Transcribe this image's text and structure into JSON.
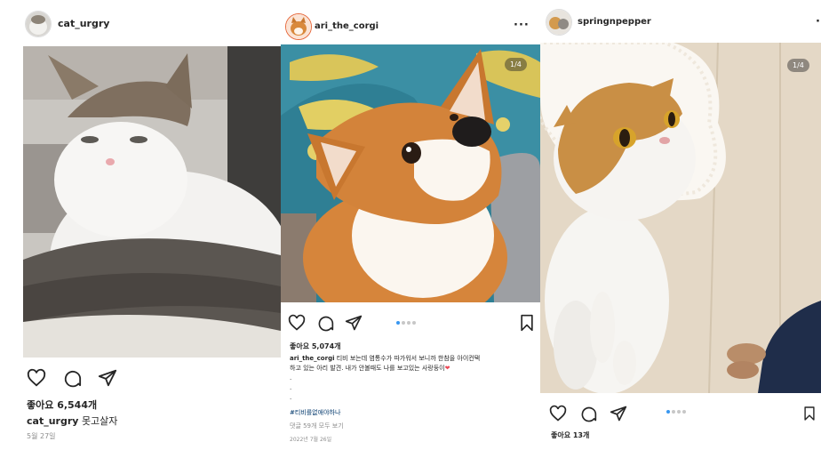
{
  "posts": [
    {
      "username": "cat_urgry",
      "likes": "좋아요 6,544개",
      "caption_user": "cat_urgry",
      "caption_text": "못고살자",
      "date": "5월 27일"
    },
    {
      "username": "ari_the_corgi",
      "more": "···",
      "counter": "1/4",
      "likes": "좋아요 5,074개",
      "caption_user": "ari_the_corgi",
      "caption_line1": "티비 보는데 염통수가 따가워서 보니까 한참을 아이컨택",
      "caption_line2": "하고 있는 아리 발견. 내가 안볼때도 나를 보고있는 사랑둥이",
      "caption_emoji": "❤",
      "hashtag": "#티비를없애야하나",
      "comments": "댓글 59개 모두 보기",
      "date": "2022년 7월 26일"
    },
    {
      "username": "springnpepper",
      "more": "·",
      "counter": "1/4",
      "likes": "좋아요 13개"
    }
  ],
  "colors": {
    "accent": "#3897f0",
    "heart": "#ed4956",
    "text": "#262626",
    "muted": "#8e8e8e"
  }
}
